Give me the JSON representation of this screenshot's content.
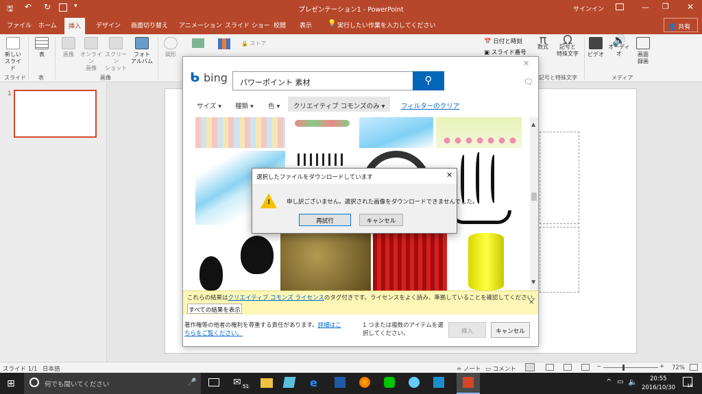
{
  "window": {
    "title": "プレゼンテーション1 - PowerPoint",
    "signin": "サインイン"
  },
  "tabs": [
    "ファイル",
    "ホーム",
    "挿入",
    "デザイン",
    "画面切り替え",
    "アニメーション",
    "スライド ショー",
    "校閲",
    "表示"
  ],
  "active_tab": "挿入",
  "tell_me": "実行したい作業を入力してください",
  "share": "共有",
  "ribbon": {
    "new_slide": "新しい スライド",
    "new_slide_l1": "新しい",
    "new_slide_l2": "スライド",
    "table": "表",
    "image": "画像",
    "online_l1": "オンライン",
    "online_l2": "画像",
    "screenshot_l1": "スクリーン",
    "screenshot_l2": "ショット",
    "photo_l1": "フォト",
    "photo_l2": "アルバム",
    "shapes": "図形",
    "store": "ストア",
    "date_time": "日付と時刻",
    "slide_number": "スライド番号",
    "equation": "数式",
    "symbol_l1": "記号と",
    "symbol_l2": "特殊文字",
    "video": "ビデオ",
    "audio": "オーディオ",
    "screen_rec_l1": "画面",
    "screen_rec_l2": "録画",
    "group_slide": "スライド",
    "group_table": "表",
    "group_image": "画像",
    "group_symbols": "記号と特殊文字",
    "group_media": "メディア"
  },
  "thumbs": {
    "num": "1"
  },
  "bing": {
    "logo": "bing",
    "query": "パワーポイント 素材",
    "filters": {
      "size": "サイズ",
      "type": "種類",
      "color": "色",
      "license": "クリエイティブ コモンズのみ",
      "clear": "フィルターのクリア"
    },
    "notice_pre": "これらの結果は",
    "notice_link": "クリエイティブ コモンズ ライセンス",
    "notice_post": "のタグ付きです。ライセンスをよく読み、準拠していることを確認してください。",
    "show_all": "すべての結果を表示",
    "footer_left_pre": "著作権等の他者の権利を尊重する責任があります。",
    "footer_left_link1": "詳細はこ",
    "footer_left_link2": "ちらをご覧ください。",
    "footer_mid_l1": "1 つまたは複数のアイテムを選",
    "footer_mid_l2": "択してください。",
    "insert": "挿入",
    "cancel": "キャンセル"
  },
  "error_dialog": {
    "title": "選択したファイルをダウンロードしています",
    "message": "申し訳ございません。選択された画像をダウンロードできませんでした。",
    "retry": "再試行",
    "cancel": "キャンセル"
  },
  "status": {
    "slide": "スライド 1/1",
    "lang": "日本語",
    "notes": "ノート",
    "comments": "コメント",
    "zoom": "72%"
  },
  "taskbar": {
    "search": "何でも聞いてください",
    "mail_badge": "51",
    "time": "20:55",
    "date": "2016/10/30",
    "notif": "18"
  },
  "colors": {
    "accent": "#b7472a",
    "bing_blue": "#0067b8",
    "link": "#0066cc"
  }
}
